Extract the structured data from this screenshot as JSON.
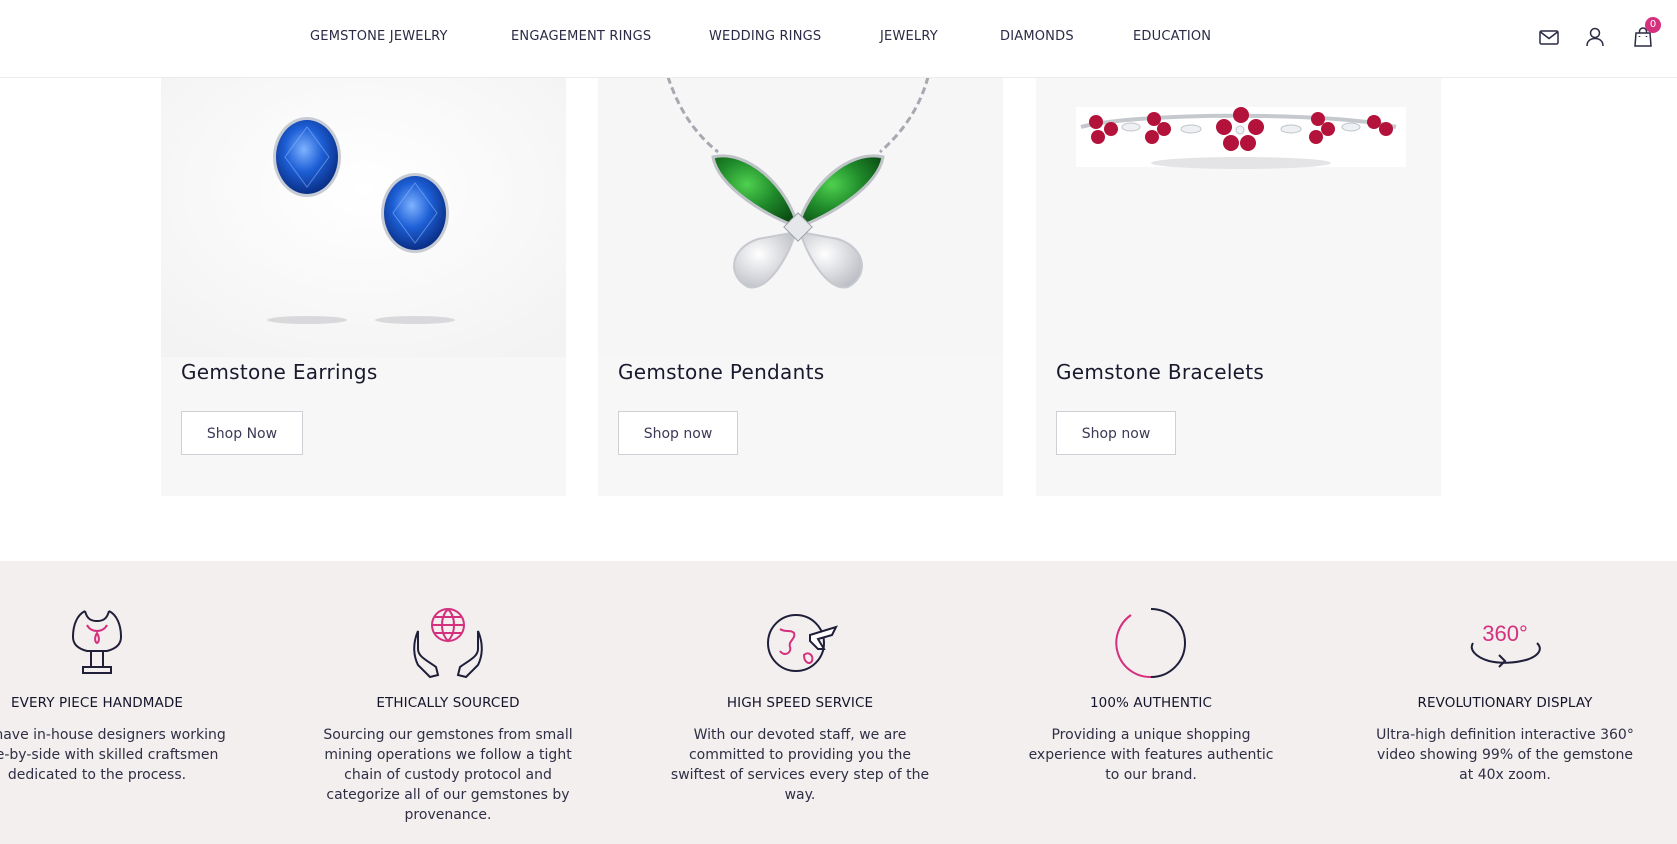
{
  "nav": {
    "items": [
      {
        "label": "GEMSTONE JEWELRY"
      },
      {
        "label": "ENGAGEMENT RINGS"
      },
      {
        "label": "WEDDING RINGS"
      },
      {
        "label": "JEWELRY"
      },
      {
        "label": "DIAMONDS"
      },
      {
        "label": "EDUCATION"
      }
    ],
    "icons": [
      "mail-icon",
      "user-icon",
      "shopping-bag-icon"
    ],
    "cart_count": "0"
  },
  "cards": [
    {
      "title": "Gemstone Earrings",
      "button": "Shop Now",
      "image": "sapphire-earrings"
    },
    {
      "title": "Gemstone Pendants",
      "button": "Shop now",
      "image": "emerald-butterfly-pendant"
    },
    {
      "title": "Gemstone Bracelets",
      "button": "Shop now",
      "image": "ruby-flower-bracelet"
    }
  ],
  "features": [
    {
      "title": "EVERY PIECE HANDMADE",
      "text": "We have in-house designers working side-by-side with skilled craftsmen dedicated to the process.",
      "icon": "bust-necklace-icon"
    },
    {
      "title": "ETHICALLY SOURCED",
      "text": "Sourcing our gemstones from small mining operations we follow a tight chain of custody protocol and categorize all of our gemstones by provenance.",
      "icon": "globe-hands-icon"
    },
    {
      "title": "HIGH SPEED SERVICE",
      "text": "With our devoted staff, we are committed to providing you the swiftest of services every step of the way.",
      "icon": "globe-plane-icon"
    },
    {
      "title": "100% AUTHENTIC",
      "text": "Providing a unique shopping experience with features authentic to our brand.",
      "icon": "circle-icon"
    },
    {
      "title": "REVOLUTIONARY DISPLAY",
      "text": "Ultra-high definition interactive 360° video showing 99% of the gemstone at 40x zoom.",
      "icon": "rotate-360-icon",
      "icon_text": "360°"
    }
  ],
  "colors": {
    "accent": "#d4307e",
    "navy": "#1f1f3a",
    "feature_bg": "#f3efee",
    "sapphire": "#1d5fd6",
    "emerald": "#1f8a2a",
    "ruby": "#b3123b"
  }
}
